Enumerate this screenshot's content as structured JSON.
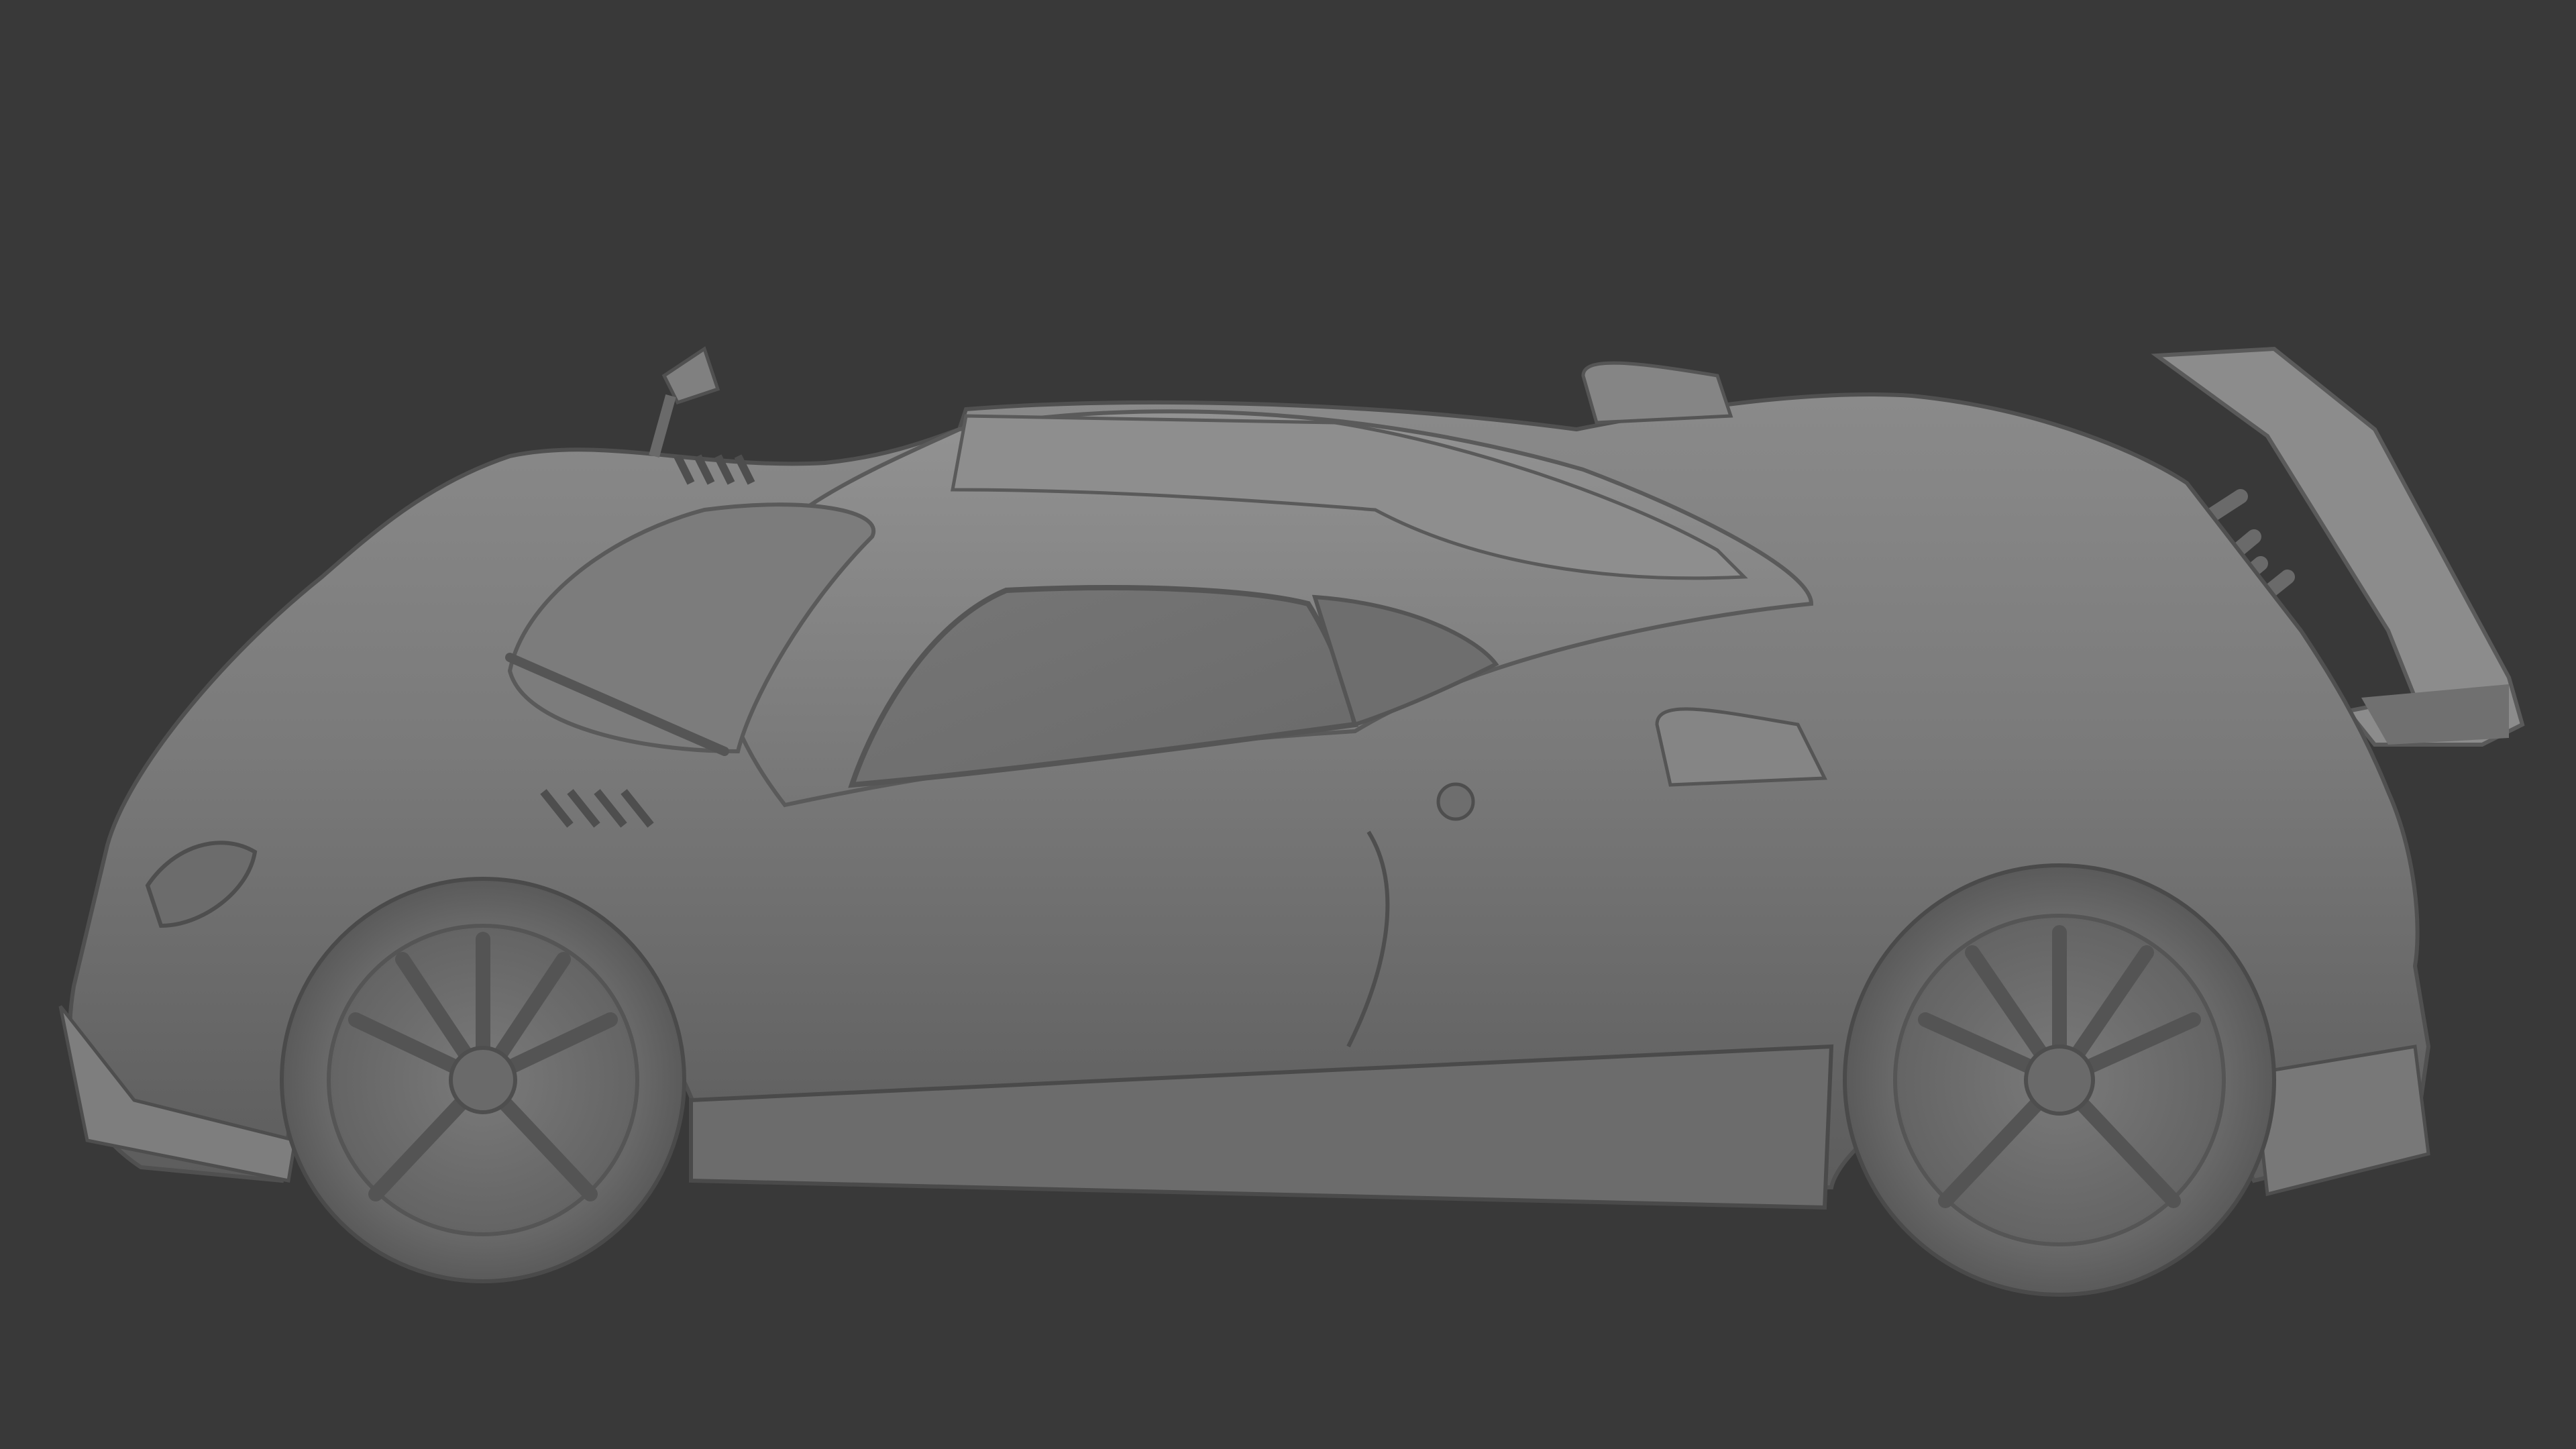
{
  "viewport": {
    "background_color": "#393939"
  },
  "model": {
    "render_mode": "clay-shaded",
    "body_color": "#7a7a7a",
    "highlight_color": "#9a9a9a",
    "shadow_color": "#4a4a4a",
    "subject": "supercar-side-three-quarter-view"
  }
}
